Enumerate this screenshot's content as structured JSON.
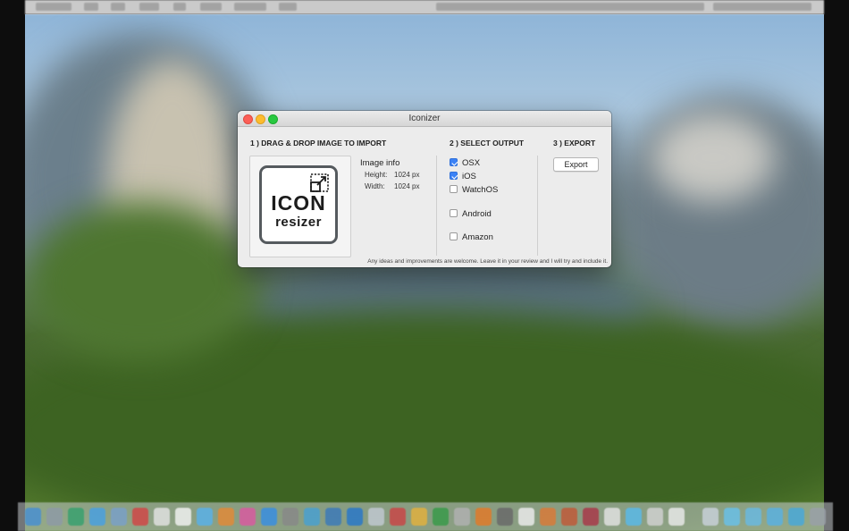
{
  "window": {
    "title": "Iconizer"
  },
  "import_section": {
    "heading": "1 ) DRAG & DROP IMAGE TO IMPORT",
    "icon_text_line1": "ICON",
    "icon_text_line2": "resizer",
    "image_info_title": "Image info",
    "height_label": "Height:",
    "height_value": "1024 px",
    "width_label": "Width:",
    "width_value": "1024 px"
  },
  "output_section": {
    "heading": "2 ) SELECT OUTPUT",
    "options": [
      {
        "label": "OSX",
        "checked": true
      },
      {
        "label": "iOS",
        "checked": true
      },
      {
        "label": "WatchOS",
        "checked": false
      },
      {
        "label": "Android",
        "checked": false
      },
      {
        "label": "Amazon",
        "checked": false
      }
    ]
  },
  "export_section": {
    "heading": "3 ) EXPORT",
    "button_label": "Export"
  },
  "footer": {
    "note": "Any ideas and improvements are welcome. Leave it in your review and I will try and include it."
  },
  "colors": {
    "checkbox_accent": "#3b82f6",
    "close": "#fc5f57",
    "minimize": "#fdbc2e",
    "maximize": "#28c840"
  }
}
